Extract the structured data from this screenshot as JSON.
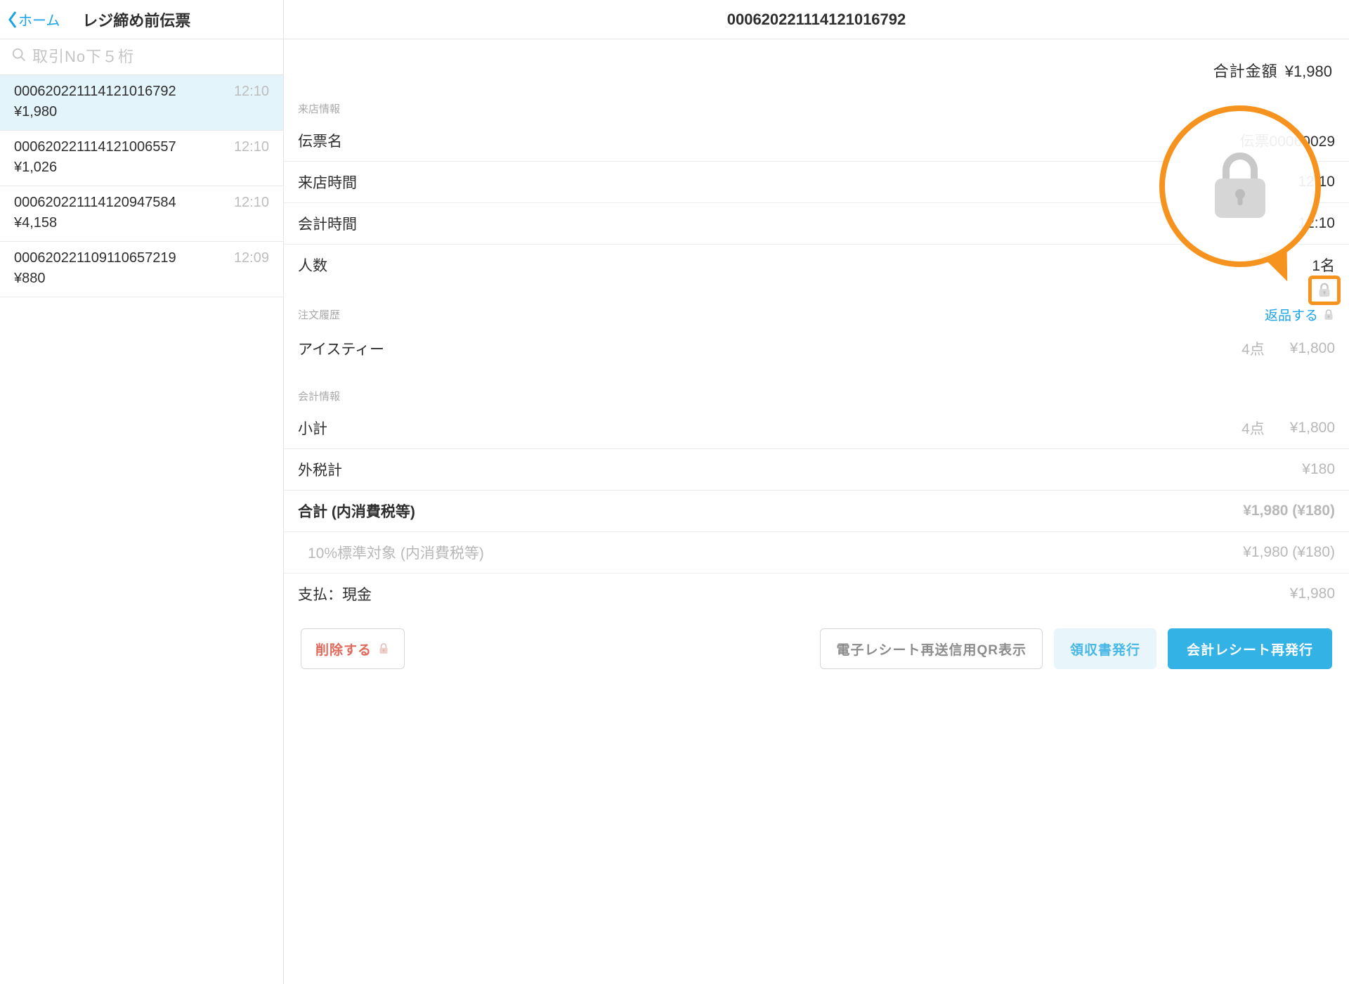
{
  "nav": {
    "back_label": "ホーム",
    "title": "レジ締め前伝票"
  },
  "search": {
    "placeholder": "取引No下５桁"
  },
  "transactions": [
    {
      "id": "000620221114121016792",
      "time": "12:10",
      "amount": "¥1,980",
      "selected": true
    },
    {
      "id": "000620221114121006557",
      "time": "12:10",
      "amount": "¥1,026",
      "selected": false
    },
    {
      "id": "000620221114120947584",
      "time": "12:10",
      "amount": "¥4,158",
      "selected": false
    },
    {
      "id": "000620221109110657219",
      "time": "12:09",
      "amount": "¥880",
      "selected": false
    }
  ],
  "detail": {
    "header_id": "000620221114121016792",
    "total_label": "合計金額",
    "total_value": "¥1,980",
    "visit_section": "来店情報",
    "fields": {
      "slip_name": {
        "label": "伝票名",
        "value": "伝票00060029"
      },
      "visit_time": {
        "label": "来店時間",
        "value": "12:10"
      },
      "checkout_time": {
        "label": "会計時間",
        "value": "12:10"
      },
      "party": {
        "label": "人数",
        "value": "1名"
      }
    },
    "order_section": "注文履歴",
    "return_label": "返品する",
    "order_items": [
      {
        "name": "アイスティー",
        "qty": "4点",
        "price": "¥1,800"
      }
    ],
    "acct_section": "会計情報",
    "acct": {
      "subtotal": {
        "label": "小計",
        "qty": "4点",
        "value": "¥1,800"
      },
      "tax_ext": {
        "label": "外税計",
        "value": "¥180"
      },
      "grand": {
        "label": "合計 (内消費税等)",
        "value": "¥1,980 (¥180)"
      },
      "tax_detail": {
        "label": "10%標準対象 (内消費税等)",
        "value": "¥1,980 (¥180)"
      },
      "payment": {
        "label": "支払：現金",
        "value": "¥1,980"
      }
    }
  },
  "footer": {
    "delete": "削除する",
    "qr": "電子レシート再送信用QR表示",
    "ryoshu": "領収書発行",
    "receipt": "会計レシート再発行"
  }
}
